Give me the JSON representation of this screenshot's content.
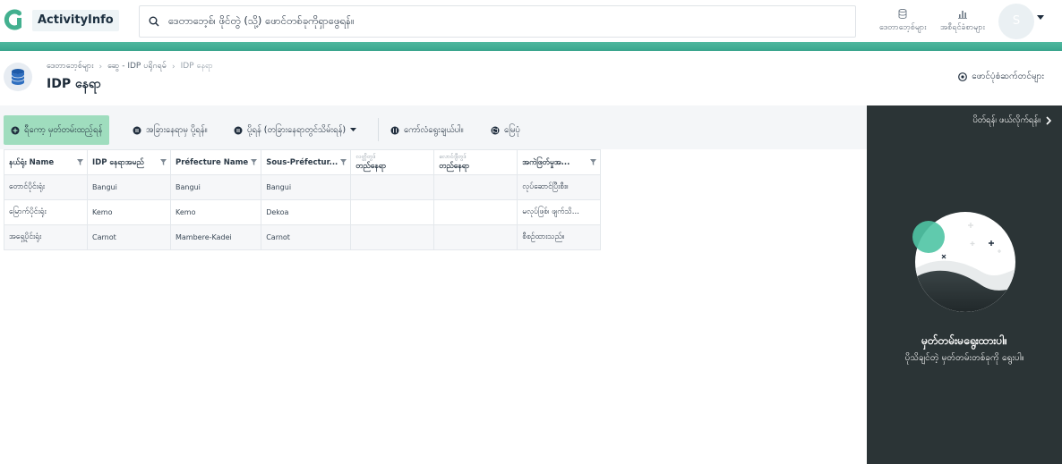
{
  "app": {
    "brand": "ActivityInfo"
  },
  "search": {
    "placeholder": "ဒေတာဘေ့စ်၊ ဖိုင်တွဲ (သို့) ဖောင်တစ်ခုကိုရှာဖွေရန်။"
  },
  "nav": {
    "databases": "ဒေတာဘေ့စ်များ",
    "reports": "အစီရင်ခံစာများ",
    "avatar_letter": "S"
  },
  "breadcrumb": {
    "items": [
      "ဒေတာဘေ့စ်များ",
      "ဆွေ - IDP ပရိုဂရမ်",
      "IDP နေရာ"
    ]
  },
  "page": {
    "title": "IDP နေရာ"
  },
  "header_actions": {
    "form_settings": "ဖောင်ပုံစံဆက်တင်များ"
  },
  "toolbar": {
    "add_record": "ရီကော့ မှတ်တမ်းထည့်ရန်",
    "import": "အခြားနေရာမှ ပို့ရန်။",
    "export": "ပို့ရန် (တခြားနေရာတွင်သိမ်းရန်)",
    "select_columns": "ကော်လံရွေးချယ်ပါ။",
    "map": "မြေပုံ"
  },
  "grid": {
    "columns": [
      {
        "sub": "",
        "label": "နယ်ရုံး Name",
        "filter": true
      },
      {
        "sub": "",
        "label": "IDP နေရာအမည်",
        "filter": true
      },
      {
        "sub": "",
        "label": "Préfecture Name",
        "filter": true
      },
      {
        "sub": "",
        "label": "Sous-Préfectur...",
        "filter": true
      },
      {
        "sub": "လတ္တိတွဒ်",
        "label": "တည်နေရာ",
        "filter": false
      },
      {
        "sub": "လောင်ဂျီတွဒ်",
        "label": "တည်နေရာ",
        "filter": false
      },
      {
        "sub": "",
        "label": "အကဲဖြတ်မှုအ...",
        "filter": true
      }
    ],
    "rows": [
      [
        "တောင်ပိုင်းရုံး",
        "Bangui",
        "Bangui",
        "Bangui",
        "",
        "",
        "လုပ်ဆောင်ပြီးစီး။"
      ],
      [
        "မြောက်ပိုင်းရုံး",
        "Kemo",
        "Kemo",
        "Dekoa",
        "",
        "",
        "မလုပ်ဖြစ်၊ ဖျက်သိ..."
      ],
      [
        "အရှေ့ပိုင်းရုံး",
        "Carnot",
        "Mambere-Kadei",
        "Carnot",
        "",
        "",
        "စီစဉ်ထားသည်။"
      ]
    ]
  },
  "panel": {
    "hide_link": "ပိတ်ရန်၊ ဖယ်လိုက်ရန်။",
    "empty_title": "မှတ်တမ်းမရွေးထားပါ။",
    "empty_desc": "ပိုသိချင်တဲ့ မှတ်တမ်းတစ်ခုကို ရွေးပါ။"
  },
  "colors": {
    "accent": "#3aa58d",
    "primary_button": "#9fddbe",
    "panel_bg": "#2b3436"
  }
}
